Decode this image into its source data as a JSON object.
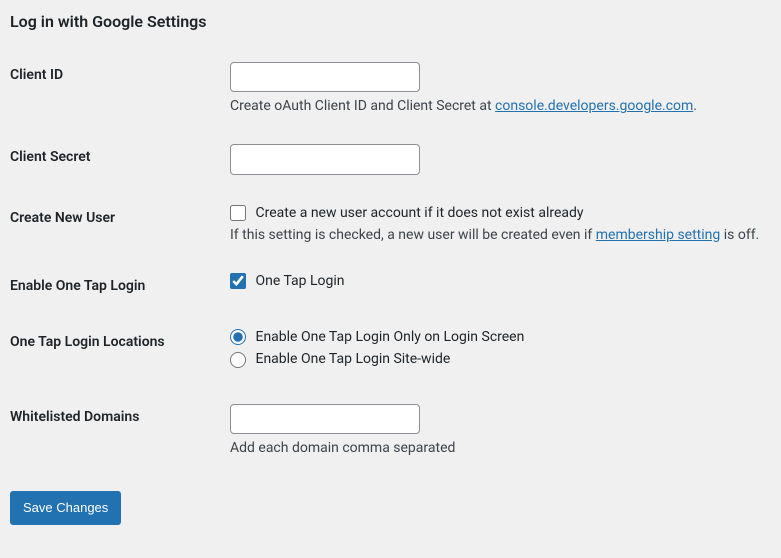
{
  "title": "Log in with Google Settings",
  "fields": {
    "client_id": {
      "label": "Client ID",
      "value": "",
      "help_prefix": "Create oAuth Client ID and Client Secret at ",
      "help_link_text": "console.developers.google.com",
      "help_suffix": "."
    },
    "client_secret": {
      "label": "Client Secret",
      "value": ""
    },
    "create_user": {
      "label": "Create New User",
      "checkbox_label": "Create a new user account if it does not exist already",
      "help_prefix": "If this setting is checked, a new user will be created even if ",
      "help_link_text": "membership setting",
      "help_suffix": " is off."
    },
    "one_tap": {
      "label": "Enable One Tap Login",
      "checkbox_label": "One Tap Login"
    },
    "one_tap_locations": {
      "label": "One Tap Login Locations",
      "option1": "Enable One Tap Login Only on Login Screen",
      "option2": "Enable One Tap Login Site-wide"
    },
    "whitelisted": {
      "label": "Whitelisted Domains",
      "value": "",
      "help": "Add each domain comma separated"
    }
  },
  "submit_label": "Save Changes"
}
